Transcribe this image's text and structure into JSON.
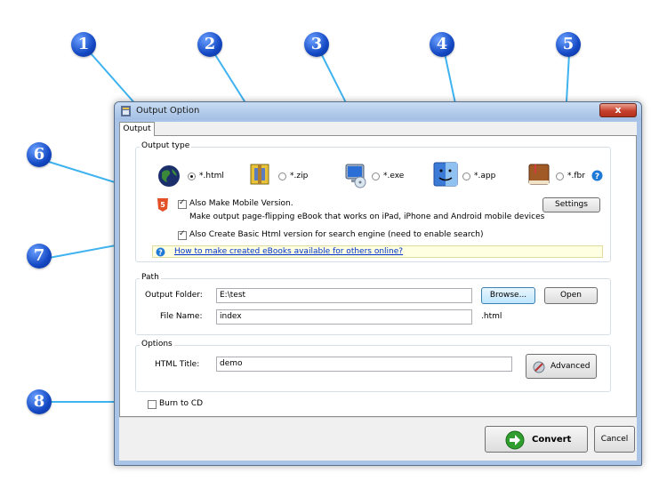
{
  "window": {
    "title": "Output Option",
    "close_label": "x"
  },
  "tabs": [
    {
      "label": "Output"
    }
  ],
  "output_type": {
    "group_label": "Output type",
    "options": [
      {
        "label": "*.html",
        "selected": true,
        "icon": "globe-icon"
      },
      {
        "label": "*.zip",
        "selected": false,
        "icon": "zip-archive-icon"
      },
      {
        "label": "*.exe",
        "selected": false,
        "icon": "computer-cd-icon"
      },
      {
        "label": "*.app",
        "selected": false,
        "icon": "mac-finder-icon"
      },
      {
        "label": "*.fbr",
        "selected": false,
        "icon": "book-icon"
      }
    ],
    "help_icon": "help-icon",
    "mobile_checkbox_label": "Also Make Mobile Version.",
    "mobile_description": "Make output page-flipping eBook that works on iPad, iPhone and Android mobile devices",
    "settings_label": "Settings",
    "basic_html_label": "Also Create Basic Html version for search engine (need to enable search)",
    "info_link": "How to make created eBooks available for others online?"
  },
  "path": {
    "group_label": "Path",
    "output_folder_label": "Output Folder:",
    "output_folder_value": "E:\\test",
    "browse_label": "Browse...",
    "open_label": "Open",
    "file_name_label": "File Name:",
    "file_name_value": "index",
    "extension": ".html"
  },
  "options": {
    "group_label": "Options",
    "html_title_label": "HTML Title:",
    "html_title_value": "demo",
    "advanced_label": "Advanced"
  },
  "burn_to_cd_label": "Burn to CD",
  "footer": {
    "convert_label": "Convert",
    "cancel_label": "Cancel"
  },
  "callouts": [
    "1",
    "2",
    "3",
    "4",
    "5",
    "6",
    "7",
    "8"
  ],
  "colors": {
    "callout_blue": "#1449c4",
    "callout_line": "#3fb3f0",
    "window_frame": "#a9c4e6"
  }
}
